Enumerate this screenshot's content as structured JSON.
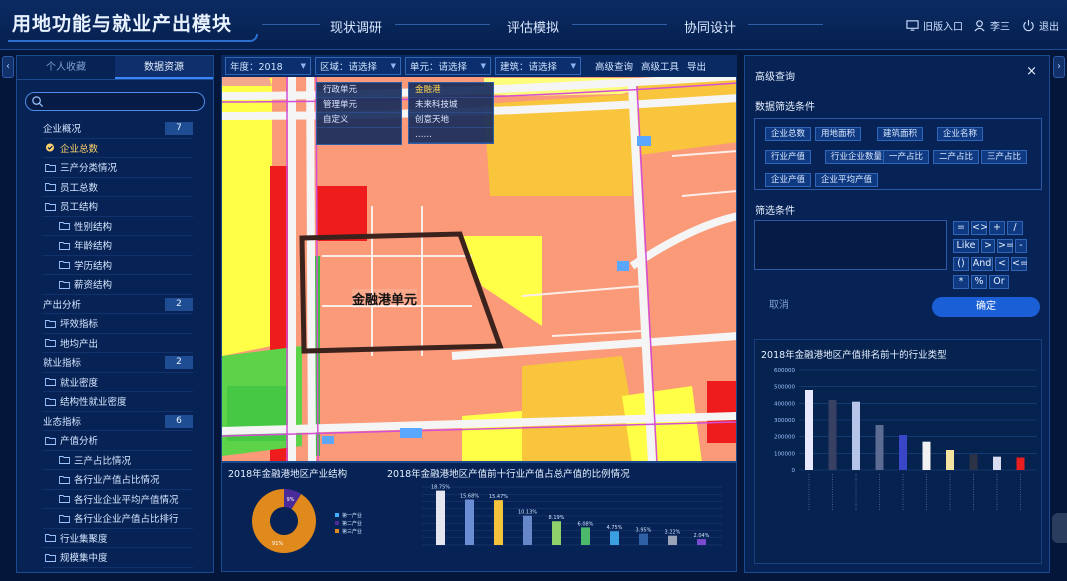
{
  "header": {
    "title": "用地功能与就业产出模块",
    "nav": [
      "现状调研",
      "评估模拟",
      "协同设计"
    ],
    "old_version": "旧版入口",
    "user": "李三",
    "logout": "退出"
  },
  "left_panel": {
    "tabs": [
      "个人收藏",
      "数据资源"
    ],
    "search_placeholder": "",
    "tree": [
      {
        "label": "企业概况",
        "level": 1,
        "badge": "7"
      },
      {
        "label": "企业总数",
        "level": 2,
        "selected": true
      },
      {
        "label": "三产分类情况",
        "level": 2
      },
      {
        "label": "员工总数",
        "level": 2
      },
      {
        "label": "员工结构",
        "level": 2
      },
      {
        "label": "性别结构",
        "level": 3
      },
      {
        "label": "年龄结构",
        "level": 3
      },
      {
        "label": "学历结构",
        "level": 3
      },
      {
        "label": "薪资结构",
        "level": 3
      },
      {
        "label": "产出分析",
        "level": 1,
        "badge": "2"
      },
      {
        "label": "坪效指标",
        "level": 2
      },
      {
        "label": "地均产出",
        "level": 2
      },
      {
        "label": "就业指标",
        "level": 1,
        "badge": "2"
      },
      {
        "label": "就业密度",
        "level": 2
      },
      {
        "label": "结构性就业密度",
        "level": 2
      },
      {
        "label": "业态指标",
        "level": 1,
        "badge": "6"
      },
      {
        "label": "产值分析",
        "level": 2
      },
      {
        "label": "三产占比情况",
        "level": 3
      },
      {
        "label": "各行业产值占比情况",
        "level": 3
      },
      {
        "label": "各行业企业平均产值情况",
        "level": 3
      },
      {
        "label": "各行业企业产值占比排行",
        "level": 3
      },
      {
        "label": "行业集聚度",
        "level": 2
      },
      {
        "label": "规模集中度",
        "level": 2
      }
    ]
  },
  "map": {
    "toolbar": {
      "year": "年度：2018",
      "region": "区域：请选择",
      "unit": "单元：请选择",
      "building": "建筑：请选择",
      "advanced_query": "高级查询",
      "advanced_tools": "高级工具",
      "export": "导出"
    },
    "region_options": [
      "行政单元",
      "管理单元",
      "自定义"
    ],
    "unit_options": [
      "金融港",
      "未来科技城",
      "创意天地",
      "……"
    ],
    "unit_label": "金融港单元",
    "colors": {
      "residential": "#fa9a79",
      "commercial": "#f8c53c",
      "yellow": "#ffff47",
      "red": "#ee1c1c",
      "green": "#4fd24a",
      "road": "#f2f2f2"
    }
  },
  "bottom": {
    "pie_title": "2018年金融港地区产业结构",
    "pie_legend": [
      "第一产业",
      "第二产业",
      "第三产业"
    ],
    "pie_values": [
      "9%",
      "91%"
    ],
    "bar_title": "2018年金融港地区产值前十行业产值占总产值的比例情况"
  },
  "right_panel": {
    "title": "高级查询",
    "close": "×",
    "fields_title": "数据筛选条件",
    "fields": [
      "企业总数",
      "用地面积",
      "建筑面积",
      "企业名称",
      "行业产值",
      "行业企业数量",
      "一产占比",
      "二产占比",
      "三产占比",
      "企业产值",
      "企业平均产值"
    ],
    "cond_title": "筛选条件",
    "operators": [
      "=",
      "<>",
      "+",
      "/",
      "Like",
      ">",
      ">=",
      "-",
      "()",
      "And",
      "<",
      "<=",
      "*",
      "%",
      "Or"
    ],
    "cancel": "取消",
    "ok": "确定",
    "chart_title": "2018年金融港地区产值排名前十的行业类型"
  },
  "chart_data": [
    {
      "type": "pie",
      "title": "2018年金融港地区产业结构",
      "legend": [
        "第一产业",
        "第二产业",
        "第三产业"
      ],
      "values": [
        0,
        9,
        91
      ],
      "labels": [
        "",
        "9%",
        "91%"
      ],
      "colors": [
        "#3fb0ff",
        "#4b2a9a",
        "#e08a1e"
      ]
    },
    {
      "type": "bar",
      "title": "2018年金融港地区产值前十行业产值占总产值的比例情况",
      "values": [
        18.75,
        15.68,
        15.47,
        10.13,
        8.19,
        6.08,
        4.75,
        3.95,
        3.22,
        2.04
      ],
      "labels": [
        "18.75%",
        "15.68%",
        "15.47%",
        "10.13%",
        "8.19%",
        "6.08%",
        "4.75%",
        "3.95%",
        "3.22%",
        "2.04%"
      ],
      "colors": [
        "#e6e6f0",
        "#6a8dd4",
        "#f5c23d",
        "#6688c8",
        "#8fd16a",
        "#4bb86c",
        "#3aa0e0",
        "#2f5fa5",
        "#9aa4b8",
        "#7a4bd0"
      ]
    },
    {
      "type": "bar",
      "title": "2018年金融港地区产值排名前十的行业类型",
      "ylim": [
        0,
        600000
      ],
      "yticks": [
        "600000",
        "500000",
        "400000",
        "300000",
        "200000",
        "100000",
        "0"
      ],
      "values": [
        480000,
        420000,
        410000,
        270000,
        210000,
        170000,
        120000,
        95000,
        80000,
        75000
      ],
      "colors": [
        "#e8e8ff",
        "#384064",
        "#b7c4ea",
        "#5b6b92",
        "#3a46c8",
        "#f2f2f2",
        "#f6e3a0",
        "#2c3347",
        "#d8dcf0",
        "#e81f1f"
      ]
    }
  ]
}
